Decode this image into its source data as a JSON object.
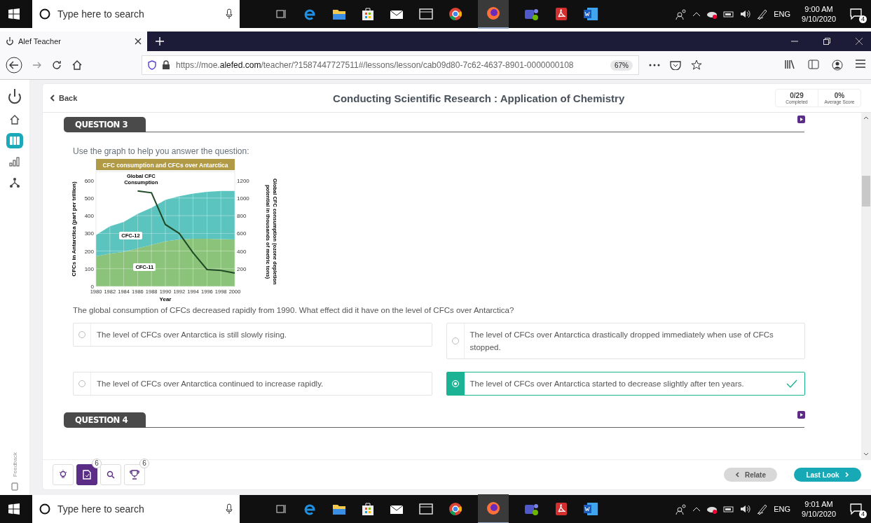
{
  "taskbars": [
    {
      "search_placeholder": "Type here to search",
      "language": "ENG",
      "time": "9:00 AM",
      "date": "9/10/2020",
      "notifications": "4"
    },
    {
      "search_placeholder": "Type here to search",
      "language": "ENG",
      "time": "9:01 AM",
      "date": "9/10/2020",
      "notifications": "4"
    }
  ],
  "browser": {
    "tab_title": "Alef Teacher",
    "url": "https://moe.**alefed.com**/teacher/?1587447727511#/lessons/lesson/cab09d80-7c62-4637-8901-0000000108",
    "zoom": "67%"
  },
  "sidebar": {
    "items": [
      {
        "kind": "home",
        "selected": false
      },
      {
        "kind": "lessons",
        "selected": true
      },
      {
        "kind": "stats",
        "selected": false
      },
      {
        "kind": "tree",
        "selected": false
      }
    ]
  },
  "header": {
    "back": "Back",
    "title": "Conducting Scientific Research : Application of Chemistry",
    "stats": [
      {
        "value": "0/29",
        "label": "Completed"
      },
      {
        "value": "0%",
        "label": "Average Score"
      }
    ]
  },
  "questions": [
    {
      "label": "QUESTION 3",
      "prompt": "Use the graph to help you answer the question:",
      "chart_data": {
        "type": "area",
        "title": "CFC consumption and CFCs over Antarctica",
        "xlabel": "Year",
        "ylabel": "CFCs in Antarctica (part per trillion)",
        "y2label": "Global CFC consumption (ozone depletion potential in thousands of metric tons)",
        "stacked": true,
        "grid": true,
        "x": [
          1980,
          1982,
          1984,
          1986,
          1988,
          1990,
          1992,
          1994,
          1996,
          1998,
          2000
        ],
        "xlim": [
          1980,
          2000
        ],
        "ylim": [
          0,
          650
        ],
        "y2lim": [
          0,
          1300
        ],
        "xticks": [
          1980,
          1982,
          1984,
          1986,
          1988,
          1990,
          1992,
          1994,
          1996,
          1998,
          2000
        ],
        "yticks": [
          0,
          100,
          200,
          300,
          400,
          500,
          600
        ],
        "y2ticks": [
          200,
          400,
          600,
          800,
          1000,
          1200
        ],
        "series": [
          {
            "name": "CFC-11",
            "color": "#8cc37a",
            "values": [
              170,
              185,
              195,
              215,
              235,
              255,
              265,
              270,
              270,
              268,
              265
            ]
          },
          {
            "name": "CFC-12",
            "color": "#5cc4bf",
            "values": [
              120,
              155,
              170,
              195,
              210,
              235,
              245,
              255,
              265,
              272,
              275
            ]
          },
          {
            "name": "Global CFC Consumption",
            "color": "#1f4a25",
            "type": "line",
            "axis": "y2",
            "values": [
              null,
              null,
              null,
              1080,
              1060,
              700,
              600,
              380,
              190,
              180,
              150
            ]
          }
        ]
      },
      "question": "The global consumption of CFCs decreased rapidly from 1990. What effect did it have on the level of CFCs over Antarctica?",
      "options": [
        {
          "text": "The level of CFCs over Antarctica is still slowly rising.",
          "selected": false
        },
        {
          "text": "The level of CFCs over Antarctica drastically dropped immediately when use of CFCs stopped.",
          "selected": false
        },
        {
          "text": "The level of CFCs over Antarctica continued to increase rapidly.",
          "selected": false
        },
        {
          "text": "The level of CFCs over Antarctica started to decrease slightly after ten years.",
          "selected": true
        }
      ]
    },
    {
      "label": "QUESTION 4"
    }
  ],
  "feedback": "Feedback",
  "tools": [
    {
      "kind": "hint",
      "selected": false
    },
    {
      "kind": "notes",
      "selected": true,
      "badge": "6"
    },
    {
      "kind": "search",
      "selected": false
    },
    {
      "kind": "trophy",
      "selected": false,
      "badge": "6"
    }
  ],
  "nav_buttons": {
    "previous": "Relate",
    "next": "Last Look"
  }
}
